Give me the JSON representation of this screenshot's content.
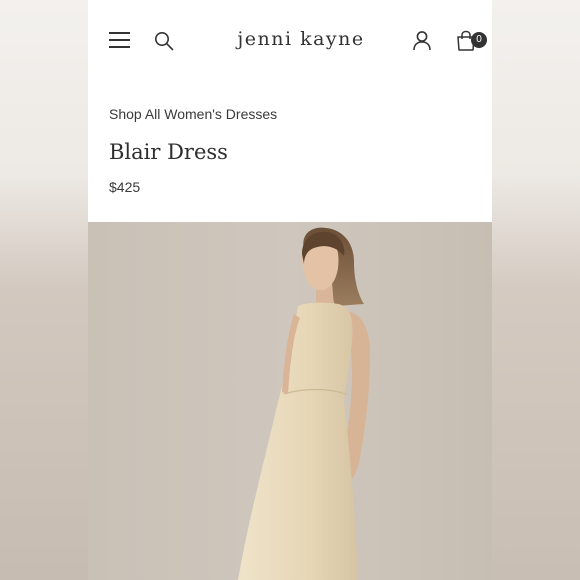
{
  "header": {
    "logo_text": "Jenni Kayne",
    "bag_count": "0"
  },
  "product": {
    "breadcrumb": "Shop All Women's Dresses",
    "title": "Blair Dress",
    "price": "$425"
  },
  "icons": {
    "menu": "hamburger-menu-icon",
    "search": "search-icon",
    "account": "user-icon",
    "bag": "shopping-bag-icon"
  },
  "colors": {
    "text": "#333333",
    "badge": "#333333",
    "dress": "#e6d7b8",
    "backdrop": "#cbc2b8"
  }
}
